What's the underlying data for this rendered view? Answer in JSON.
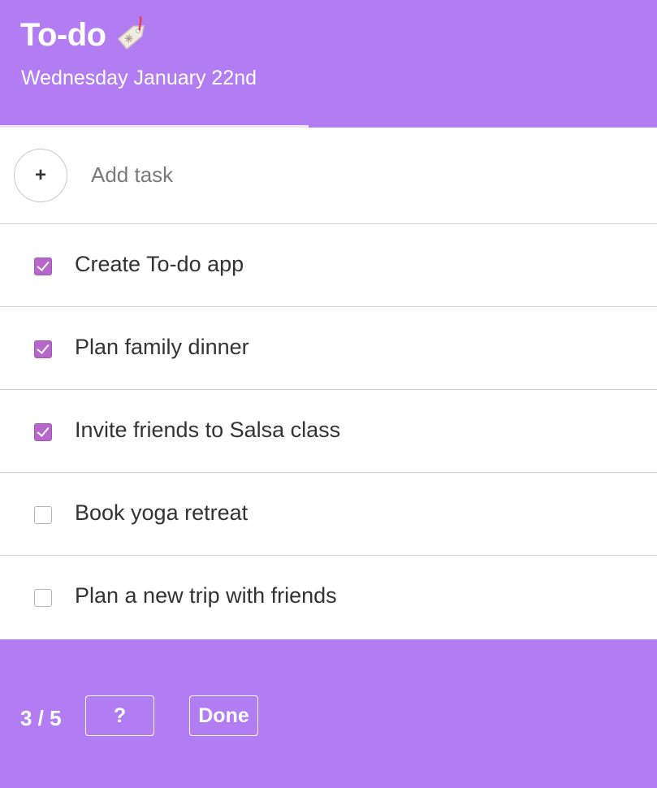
{
  "header": {
    "title": "To-do",
    "title_icon": "tag-icon",
    "date": "Wednesday January 22nd"
  },
  "progress": {
    "completed_fraction": 0.47
  },
  "add_task": {
    "button_label": "+",
    "placeholder": "Add task"
  },
  "tasks": [
    {
      "label": "Create To-do app",
      "done": true
    },
    {
      "label": "Plan family dinner",
      "done": true
    },
    {
      "label": "Invite friends to Salsa class",
      "done": true
    },
    {
      "label": "Book yoga retreat",
      "done": false
    },
    {
      "label": "Plan a new trip with friends",
      "done": false
    }
  ],
  "footer": {
    "counter": "3 / 5",
    "help_label": "?",
    "done_label": "Done"
  },
  "colors": {
    "accent": "#b27cf2",
    "checkbox_checked": "#b667c9"
  }
}
